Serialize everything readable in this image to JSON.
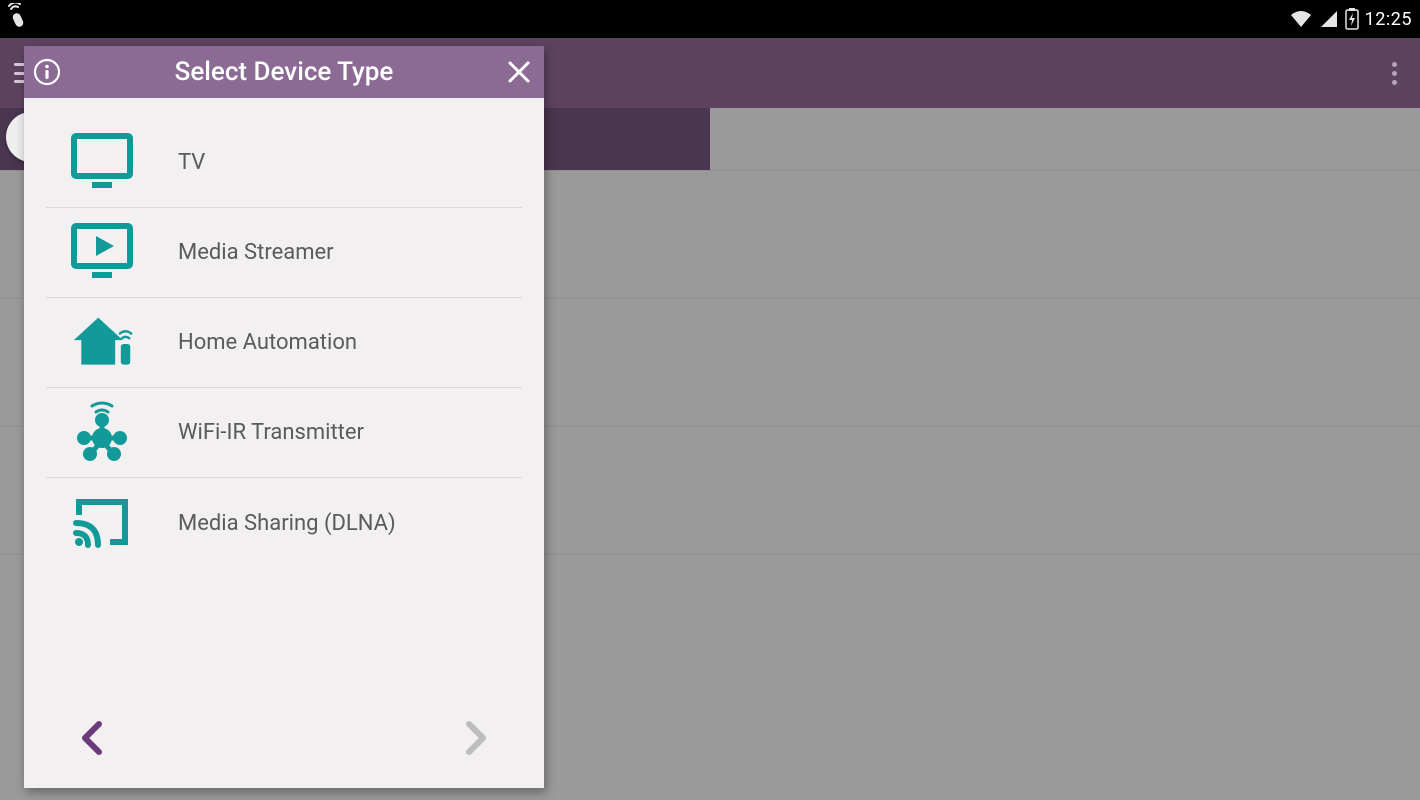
{
  "status": {
    "time": "12:25"
  },
  "dialog": {
    "title": "Select Device Type",
    "items": [
      {
        "label": "TV"
      },
      {
        "label": "Media Streamer"
      },
      {
        "label": "Home Automation"
      },
      {
        "label": "WiFi-IR Transmitter"
      },
      {
        "label": "Media Sharing (DLNA)"
      }
    ]
  },
  "colors": {
    "accent": "#129a99",
    "dialogHeader": "#8b6b94",
    "appBar": "#5e4360"
  }
}
